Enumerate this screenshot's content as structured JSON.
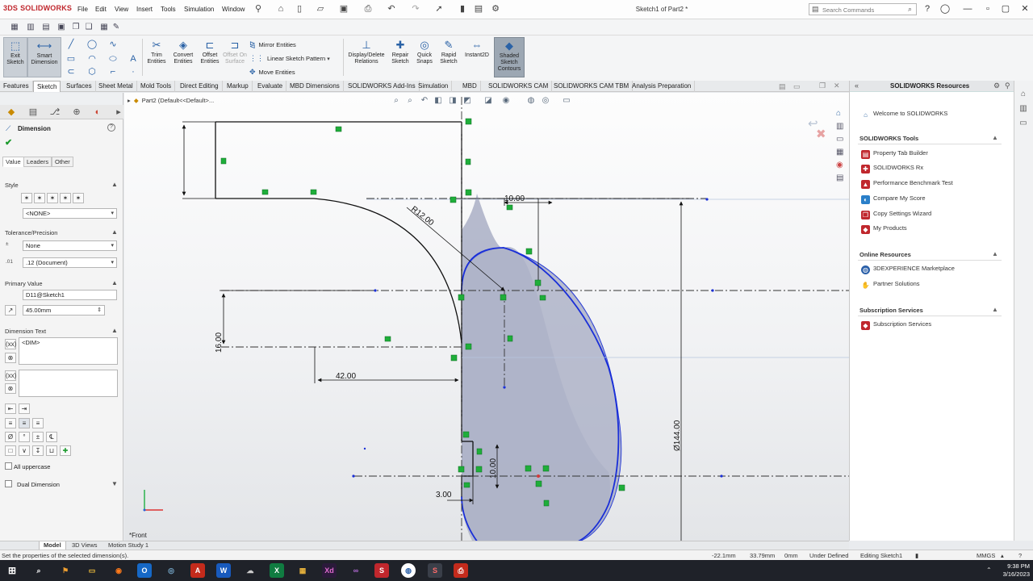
{
  "app": {
    "brand": "SOLIDWORKS",
    "brand_mark": "3DS",
    "doc_title": "Sketch1 of Part2 *",
    "menu": [
      "File",
      "Edit",
      "View",
      "Insert",
      "Tools",
      "Simulation",
      "Window"
    ],
    "search_placeholder": "Search Commands"
  },
  "command_manager": {
    "exit_sketch": "Exit Sketch",
    "smart_dimension": "Smart Dimension",
    "trim": "Trim Entities",
    "convert": "Convert Entities",
    "offset": "Offset Entities",
    "offset_surface": "Offset On Surface",
    "mirror": "Mirror Entities",
    "linear_pattern": "Linear Sketch Pattern",
    "move": "Move Entities",
    "display_delete": "Display/Delete Relations",
    "repair": "Repair Sketch",
    "quick_snaps": "Quick Snaps",
    "rapid_sketch": "Rapid Sketch",
    "instant2d": "Instant2D",
    "shaded_contours": "Shaded Sketch Contours"
  },
  "tabs": [
    "Features",
    "Sketch",
    "Surfaces",
    "Sheet Metal",
    "Mold Tools",
    "Direct Editing",
    "Markup",
    "Evaluate",
    "MBD Dimensions",
    "SOLIDWORKS Add-Ins",
    "Simulation",
    "MBD",
    "SOLIDWORKS CAM",
    "SOLIDWORKS CAM TBM",
    "Analysis Preparation"
  ],
  "active_tab": "Sketch",
  "property_manager": {
    "title": "Dimension",
    "tabs": [
      "Value",
      "Leaders",
      "Other"
    ],
    "style_label": "Style",
    "style_value": "<NONE>",
    "tolerance_label": "Tolerance/Precision",
    "tolerance_value": "None",
    "precision_value": ".12 (Document)",
    "primary_value_label": "Primary Value",
    "primary_name": "D11@Sketch1",
    "primary_value": "45.00mm",
    "dim_text_label": "Dimension Text",
    "dim_text": "<DIM>",
    "all_uppercase": "All uppercase",
    "dual_dimension": "Dual Dimension"
  },
  "graphics": {
    "tree_item": "Part2  (Default<<Default>...",
    "view_label": "*Front",
    "dimensions": {
      "radius": "R12.00",
      "top_width": "10.00",
      "height_16": "16.00",
      "horizontal_42": "42.00",
      "vertical_10": "10.00",
      "small_3": "3.00",
      "diameter": "Ø144.00"
    }
  },
  "task_pane": {
    "title": "SOLIDWORKS Resources",
    "welcome": "Welcome to SOLIDWORKS",
    "tools_header": "SOLIDWORKS Tools",
    "tools": [
      "Property Tab Builder",
      "SOLIDWORKS Rx",
      "Performance Benchmark Test",
      "Compare My Score",
      "Copy Settings Wizard",
      "My Products"
    ],
    "online_header": "Online Resources",
    "online": [
      "3DEXPERIENCE Marketplace",
      "Partner Solutions"
    ],
    "subscription_header": "Subscription Services",
    "subscription": [
      "Subscription Services"
    ]
  },
  "bottom_tabs": [
    "Model",
    "3D Views",
    "Motion Study 1"
  ],
  "status": {
    "message": "Set the properties of the selected dimension(s).",
    "x": "-22.1mm",
    "y": "33.79mm",
    "z": "0mm",
    "state": "Under Defined",
    "editing": "Editing Sketch1",
    "units": "MMGS"
  },
  "clock": {
    "time": "9:38 PM",
    "date": "3/16/2023"
  },
  "colors": {
    "accent_red": "#c0272d",
    "sketch_blue": "#1a2fd8",
    "relation_green": "#1fae3a",
    "region_fill": "#aeb3c8"
  }
}
